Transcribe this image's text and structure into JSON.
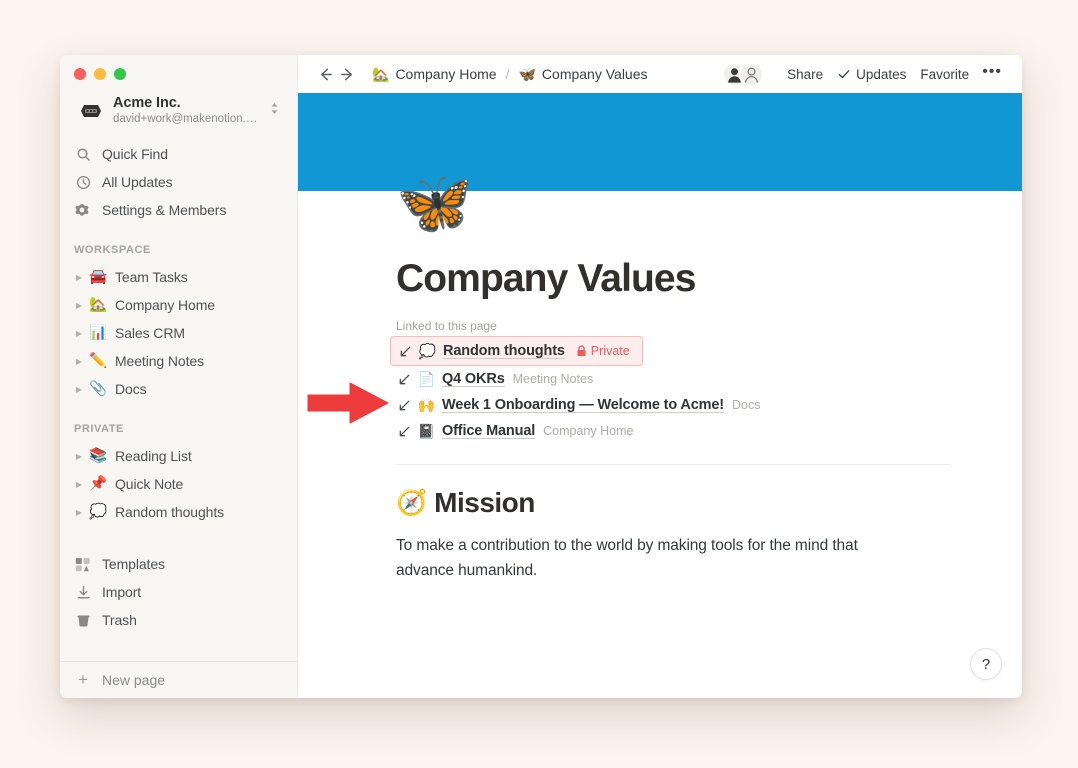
{
  "window": {
    "traffic_lights": [
      "close",
      "minimize",
      "maximize"
    ]
  },
  "sidebar": {
    "account": {
      "name": "Acme Inc.",
      "email": "david+work@makenotion.com",
      "logo_icon": "acme-logo-icon",
      "switcher_icon": "chevron-updown-icon"
    },
    "quick_actions": [
      {
        "label": "Quick Find",
        "icon": "search-icon"
      },
      {
        "label": "All Updates",
        "icon": "clock-icon"
      },
      {
        "label": "Settings & Members",
        "icon": "gear-icon"
      }
    ],
    "workspace": {
      "title": "WORKSPACE",
      "pages": [
        {
          "label": "Team Tasks",
          "emoji": "🚘"
        },
        {
          "label": "Company Home",
          "emoji": "🏡"
        },
        {
          "label": "Sales CRM",
          "emoji": "📊"
        },
        {
          "label": "Meeting Notes",
          "emoji": "✏️"
        },
        {
          "label": "Docs",
          "emoji": "📎"
        }
      ]
    },
    "private": {
      "title": "PRIVATE",
      "pages": [
        {
          "label": "Reading List",
          "emoji": "📚"
        },
        {
          "label": "Quick Note",
          "emoji": "📌"
        },
        {
          "label": "Random thoughts",
          "emoji": "💭"
        }
      ]
    },
    "bottom_items": [
      {
        "label": "Templates",
        "icon": "templates-icon"
      },
      {
        "label": "Import",
        "icon": "download-icon"
      },
      {
        "label": "Trash",
        "icon": "trash-icon"
      }
    ],
    "new_page": {
      "label": "New page",
      "icon": "plus-icon"
    }
  },
  "topbar": {
    "back_icon": "arrow-left-icon",
    "forward_icon": "arrow-right-icon",
    "breadcrumb": [
      {
        "label": "Company Home",
        "emoji": "🏡"
      },
      {
        "label": "Company Values",
        "emoji": "🦋"
      }
    ],
    "separator": "/",
    "avatars": [
      {
        "name": "collaborator-1",
        "glyph": "👨"
      },
      {
        "name": "collaborator-2",
        "glyph": "👩"
      }
    ],
    "share_label": "Share",
    "updates_label": "Updates",
    "updates_icon": "check-icon",
    "favorite_label": "Favorite",
    "more_label": "•••"
  },
  "page": {
    "cover_color": "#1198d4",
    "icon": "🦋",
    "title": "Company Values",
    "linked_label": "Linked to this page",
    "backlinks": [
      {
        "emoji": "💭",
        "title": "Random thoughts",
        "parent": "",
        "badge": "Private",
        "badge_icon": "lock-icon",
        "highlighted": true
      },
      {
        "emoji": "📄",
        "title": "Q4 OKRs",
        "parent": "Meeting Notes",
        "badge": "",
        "highlighted": false
      },
      {
        "emoji": "🙌",
        "title": "Week 1 Onboarding — Welcome to Acme!",
        "parent": "Docs",
        "badge": "",
        "highlighted": false
      },
      {
        "emoji": "📓",
        "title": "Office Manual",
        "parent": "Company Home",
        "badge": "",
        "highlighted": false
      }
    ],
    "heading": {
      "emoji": "🧭",
      "text": "Mission"
    },
    "body": "To make a contribution to the world by making tools for the mind that advance humankind."
  },
  "help": {
    "label": "?"
  },
  "annotation": {
    "arrow": "red-pointer-arrow",
    "color": "#ee3b3b",
    "points_to": "Random thoughts"
  },
  "colors": {
    "accent_blue": "#1198d4",
    "sidebar_bg": "#f7f6f3",
    "highlight_bg": "#fdeeee",
    "highlight_border": "#f6bcbc",
    "private_red": "#ec5c5c",
    "page_bg": "#fdf4ef"
  }
}
